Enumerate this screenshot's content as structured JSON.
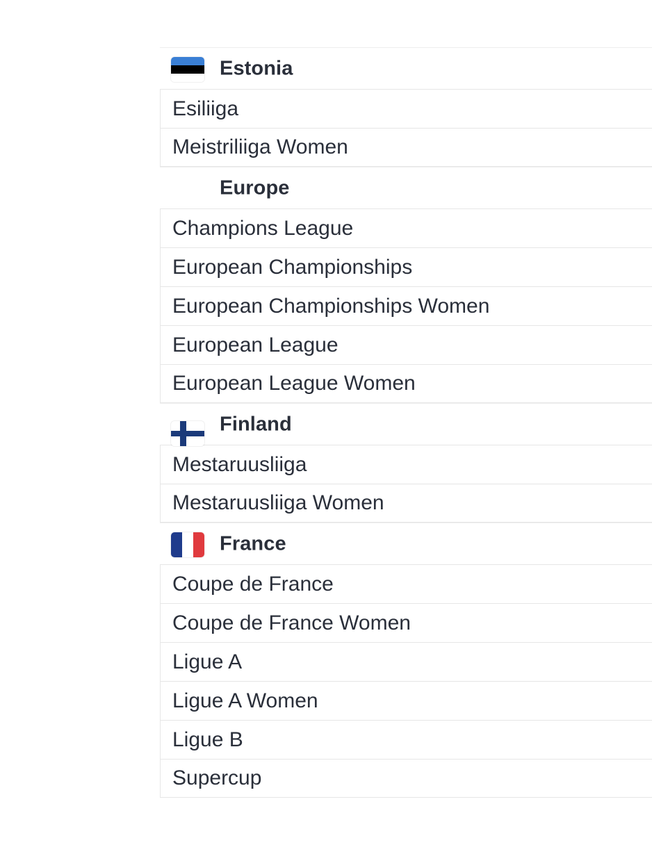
{
  "groups": [
    {
      "name": "Estonia",
      "flag_icon": "estonia-flag-icon",
      "flag_colors": [
        "#3a7fd5",
        "#000000",
        "#ffffff"
      ],
      "leagues": [
        "Esiliiga",
        "Meistriliiga Women"
      ]
    },
    {
      "name": "Europe",
      "flag_icon": "",
      "leagues": [
        "Champions League",
        "European Championships",
        "European Championships Women",
        "European League",
        "European League Women"
      ]
    },
    {
      "name": "Finland",
      "flag_icon": "finland-flag-icon",
      "flag_colors": [
        "#ffffff",
        "#1b3a7a"
      ],
      "leagues": [
        "Mestaruusliiga",
        "Mestaruusliiga Women"
      ]
    },
    {
      "name": "France",
      "flag_icon": "france-flag-icon",
      "flag_colors": [
        "#1f3b8c",
        "#ffffff",
        "#e03a3e"
      ],
      "leagues": [
        "Coupe de France",
        "Coupe de France Women",
        "Ligue A",
        "Ligue A Women",
        "Ligue B",
        "Supercup"
      ]
    }
  ]
}
